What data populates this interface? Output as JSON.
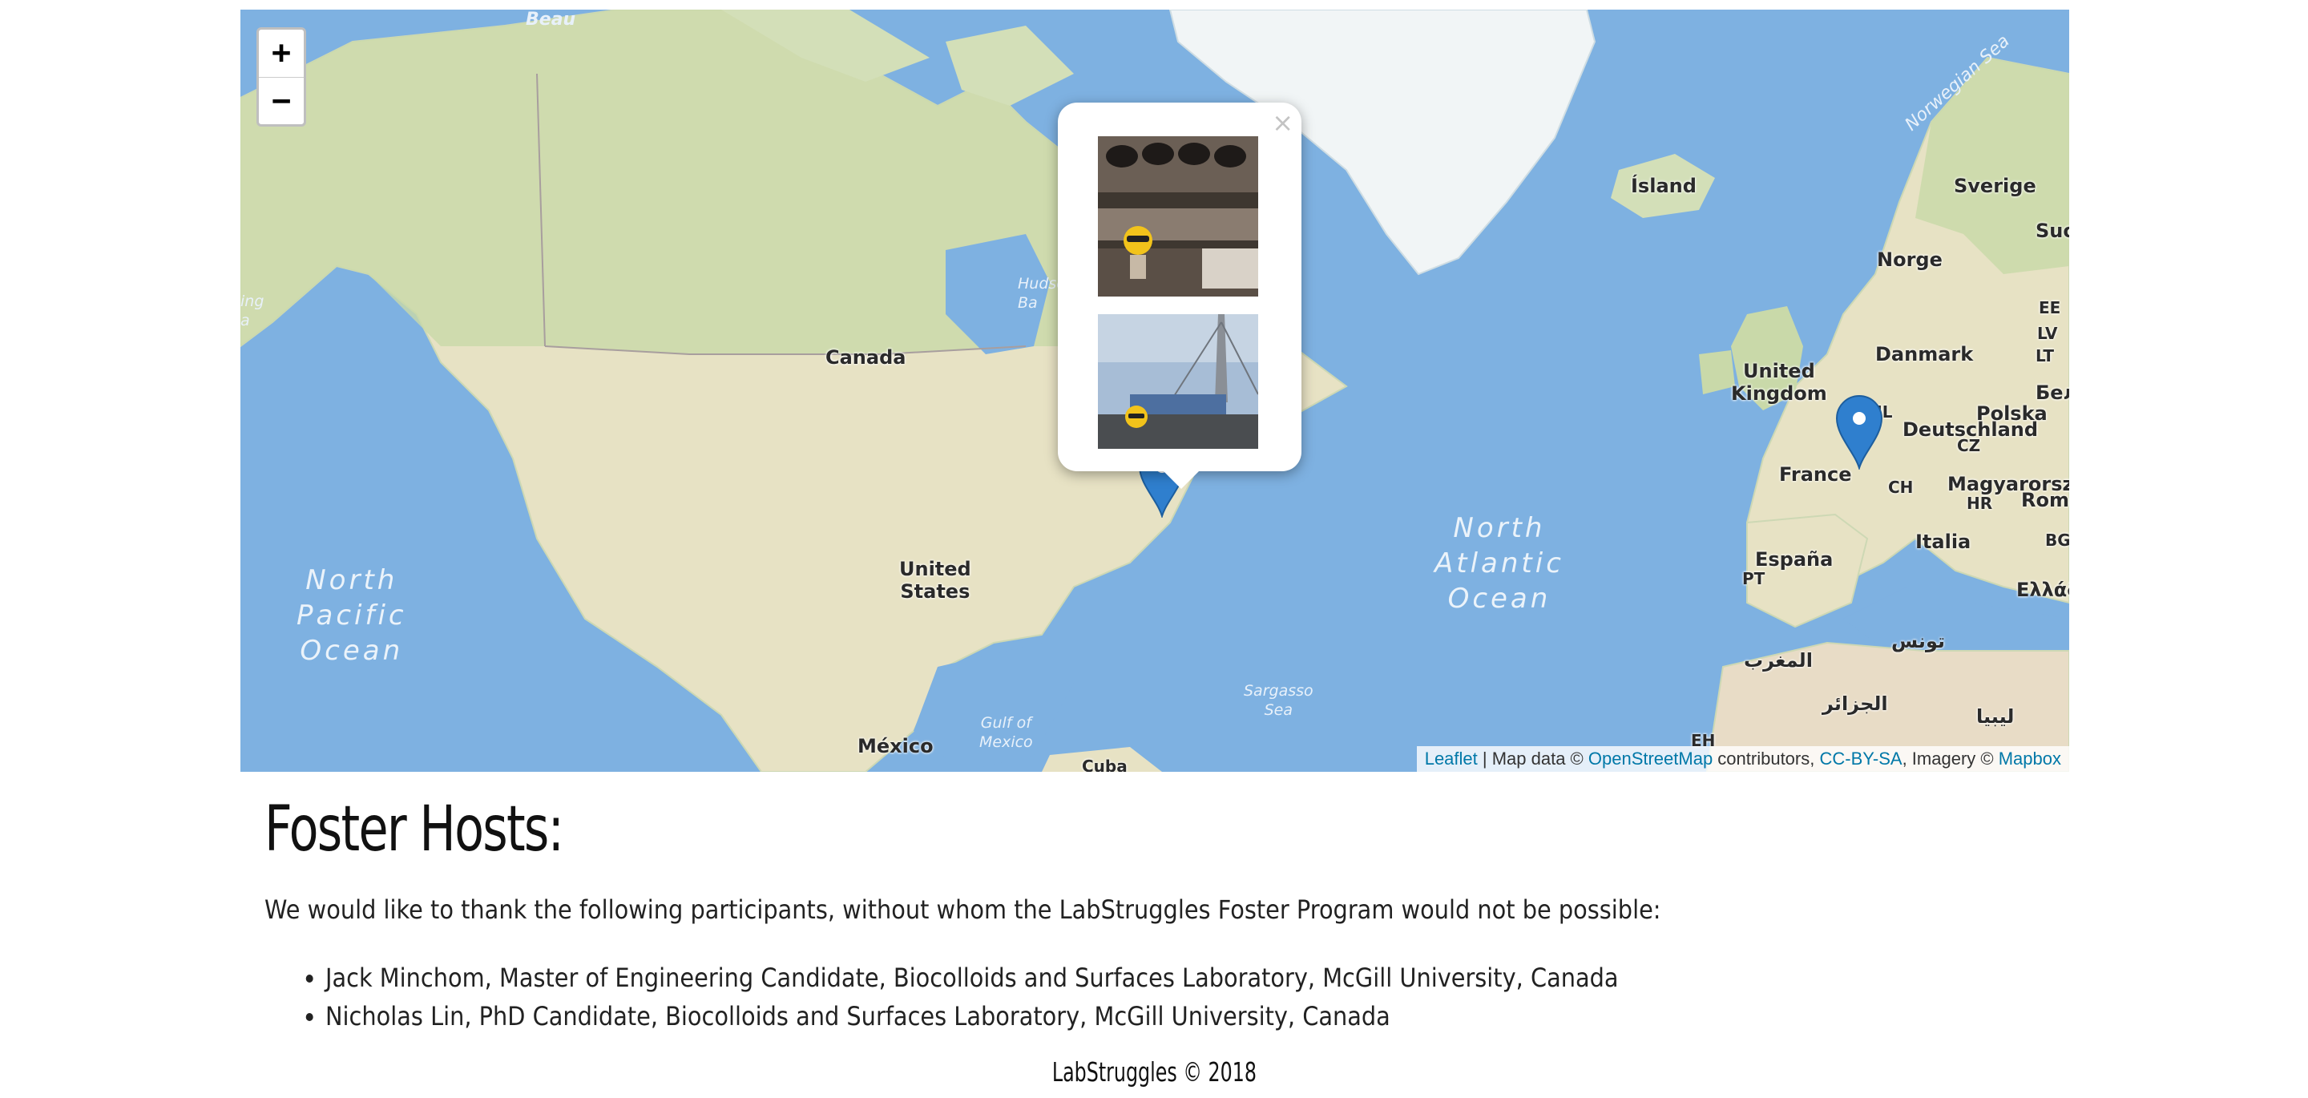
{
  "map": {
    "zoom_in_label": "+",
    "zoom_out_label": "−",
    "labels": {
      "canada": "Canada",
      "united_states": "United\nStates",
      "mexico": "México",
      "cuba": "Cuba",
      "north_pacific": "North\nPacific\nOcean",
      "north_atlantic": "North\nAtlantic\nOcean",
      "sargasso": "Sargasso\nSea",
      "gulf_mexico": "Gulf of\nMexico",
      "island": "Ísland",
      "norwegian_sea": "Norwegian Sea",
      "norge": "Norge",
      "sverige": "Sverige",
      "danmark": "Danmark",
      "united_kingdom": "United\nKingdom",
      "deutschland": "Deutschland",
      "polska": "Polska",
      "france": "France",
      "espana": "España",
      "italia": "Italia",
      "magyarorszag": "Magyarország",
      "nl": "NL",
      "cz": "CZ",
      "ch": "CH",
      "hr": "HR",
      "pt": "PT",
      "lt": "LT",
      "lv": "LV",
      "ee": "EE",
      "bg": "BG",
      "roma": "Româ",
      "suo": "Suo",
      "bel": "Бел",
      "ellada": "Ελλάδα",
      "maghreb": "المغرب",
      "algeria": "الجزائر",
      "tunisia": "تونس",
      "libya": "ليبيا",
      "eh": "EH",
      "beau": "Beau",
      "bay_partial": "Hudso\nBa",
      "ing_partial": "ing\na"
    },
    "popup_close": "×",
    "attribution": {
      "leaflet": "Leaflet",
      "sep1": " | Map data © ",
      "osm": "OpenStreetMap",
      "mid": " contributors, ",
      "license": "CC-BY-SA",
      "imagery": ", Imagery © ",
      "mapbox": "Mapbox"
    },
    "colors": {
      "water": "#7eb1e1",
      "land": "#e7e2c4",
      "marker": "#2f7fce"
    }
  },
  "page": {
    "title": "Foster Hosts:",
    "intro": "We would like to thank the following participants, without whom the LabStruggles Foster Program would not be possible:",
    "hosts": [
      "Jack Minchom, Master of Engineering Candidate, Biocolloids and Surfaces Laboratory, McGill University, Canada",
      "Nicholas Lin, PhD Candidate, Biocolloids and Surfaces Laboratory, McGill University, Canada"
    ],
    "footer": "LabStruggles © 2018"
  }
}
